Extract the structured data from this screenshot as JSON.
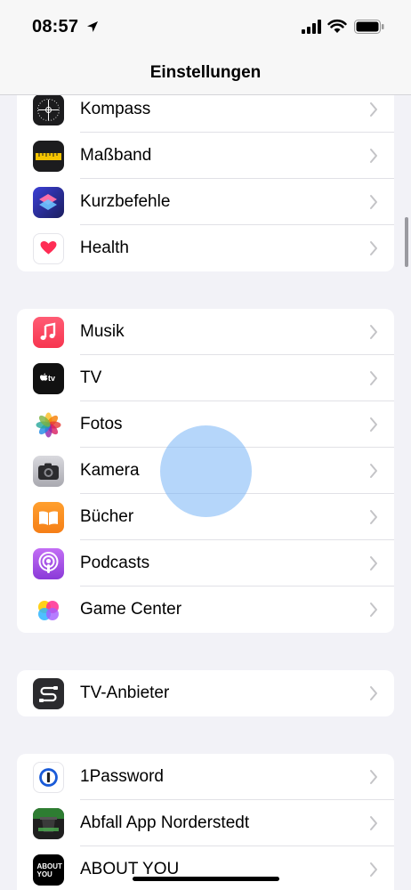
{
  "status": {
    "time": "08:57"
  },
  "nav": {
    "title": "Einstellungen"
  },
  "groups": [
    {
      "items": [
        {
          "label": "Kompass",
          "icon": "compass-icon"
        },
        {
          "label": "Maßband",
          "icon": "measure-icon"
        },
        {
          "label": "Kurzbefehle",
          "icon": "shortcuts-icon"
        },
        {
          "label": "Health",
          "icon": "health-icon"
        }
      ]
    },
    {
      "items": [
        {
          "label": "Musik",
          "icon": "music-icon"
        },
        {
          "label": "TV",
          "icon": "tv-icon"
        },
        {
          "label": "Fotos",
          "icon": "photos-icon"
        },
        {
          "label": "Kamera",
          "icon": "camera-icon"
        },
        {
          "label": "Bücher",
          "icon": "books-icon"
        },
        {
          "label": "Podcasts",
          "icon": "podcasts-icon"
        },
        {
          "label": "Game Center",
          "icon": "game-center-icon"
        }
      ]
    },
    {
      "items": [
        {
          "label": "TV-Anbieter",
          "icon": "tv-provider-icon"
        }
      ]
    },
    {
      "items": [
        {
          "label": "1Password",
          "icon": "onepassword-icon"
        },
        {
          "label": "Abfall App Norderstedt",
          "icon": "abfall-app-icon"
        },
        {
          "label": "ABOUT YOU",
          "icon": "about-you-icon",
          "icon_text": "ABOUT YOU"
        }
      ]
    }
  ],
  "tv_icon_text": "tv"
}
